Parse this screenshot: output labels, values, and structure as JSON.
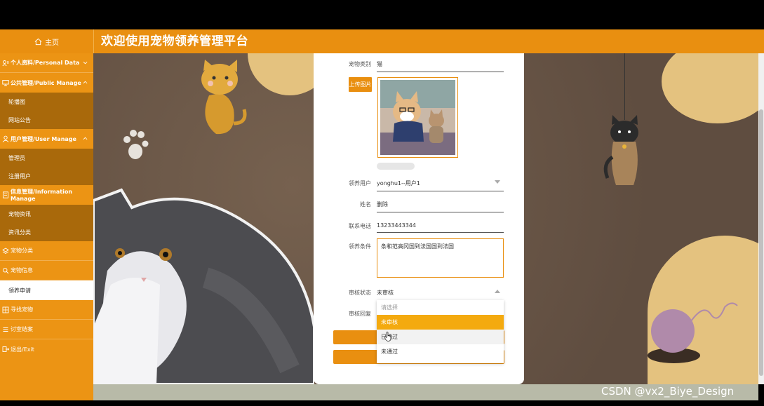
{
  "header": {
    "home_label": "主页",
    "title": "欢迎使用宠物领养管理平台"
  },
  "sidebar": {
    "items": [
      {
        "label": "个人资料/Personal Data"
      },
      {
        "label": "公共管理/Public Manage"
      },
      {
        "label": "轮播图"
      },
      {
        "label": "网站公告"
      },
      {
        "label": "用户管理/User Manage"
      },
      {
        "label": "管理员"
      },
      {
        "label": "注册用户"
      },
      {
        "label": "信息管理/Information Manage"
      },
      {
        "label": "宠物资讯"
      },
      {
        "label": "资讯分类"
      },
      {
        "label": "宠物分类"
      },
      {
        "label": "宠物信息"
      },
      {
        "label": "领养申请"
      },
      {
        "label": "寻找宠物"
      },
      {
        "label": "讨室结案"
      },
      {
        "label": "退出/Exit"
      }
    ]
  },
  "form": {
    "pet_type_label": "宠物类别",
    "pet_type_value": "猫",
    "upload_label": "上传图片",
    "adopter_label": "领养用户",
    "adopter_value": "yonghu1--用户1",
    "name_label": "姓名",
    "name_value": "删除",
    "phone_label": "联系电话",
    "phone_value": "13233443344",
    "conditions_label": "领养条件",
    "conditions_value": "条和范高冈国到法国国到法国",
    "status_label": "审核状态",
    "status_value": "未审核",
    "reply_label": "审核回复",
    "status_options": [
      {
        "label": "请选择"
      },
      {
        "label": "未审核"
      },
      {
        "label": "已通过"
      },
      {
        "label": "未通过"
      }
    ]
  },
  "watermark": "CSDN @vx2_Biye_Design",
  "colors": {
    "accent": "#e98f10",
    "submenu": "#a9690b",
    "selected_option": "#f4aa0f"
  }
}
